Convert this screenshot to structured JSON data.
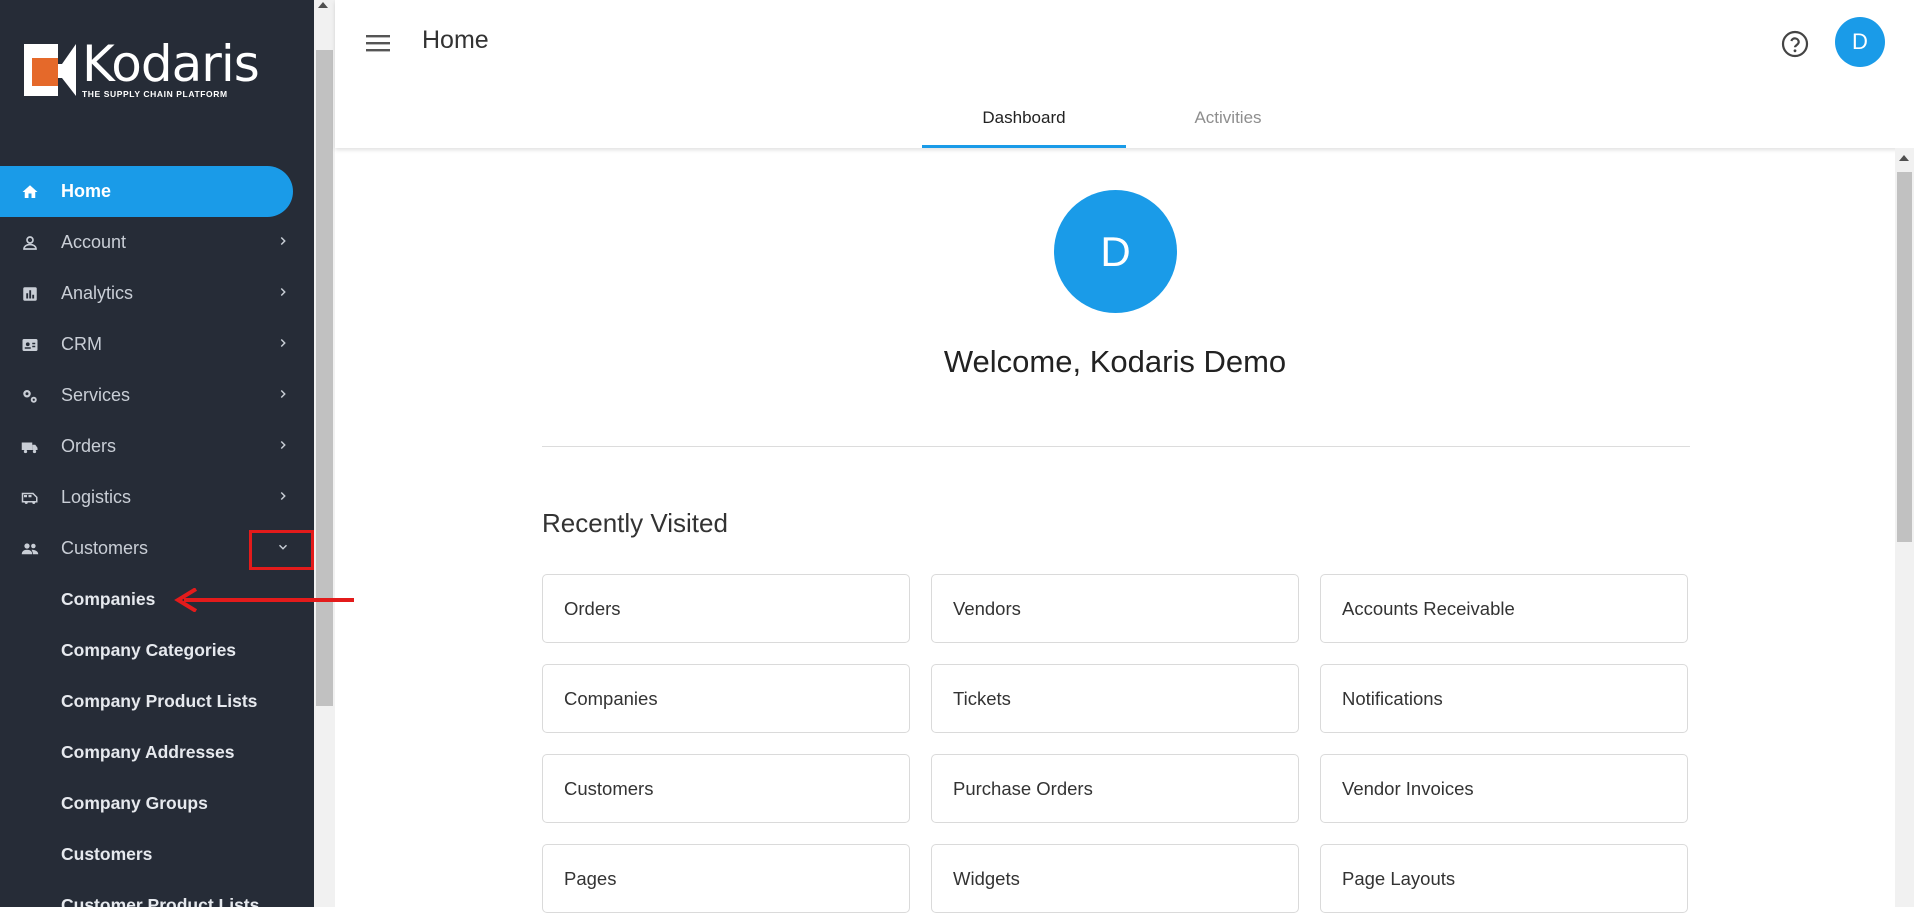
{
  "brand": {
    "name": "Kodaris",
    "tagline": "THE SUPPLY CHAIN PLATFORM",
    "accent": "#1a9be8",
    "logo_orange": "#e5692a"
  },
  "header": {
    "title": "Home",
    "avatar_initial": "D"
  },
  "tabs": [
    {
      "label": "Dashboard",
      "active": true
    },
    {
      "label": "Activities",
      "active": false
    }
  ],
  "sidebar": {
    "items": [
      {
        "label": "Home",
        "icon": "home-icon",
        "active": true
      },
      {
        "label": "Account",
        "icon": "person-icon"
      },
      {
        "label": "Analytics",
        "icon": "analytics-icon"
      },
      {
        "label": "CRM",
        "icon": "contact-card-icon"
      },
      {
        "label": "Services",
        "icon": "gears-icon"
      },
      {
        "label": "Orders",
        "icon": "truck-icon"
      },
      {
        "label": "Logistics",
        "icon": "shuttle-icon"
      },
      {
        "label": "Customers",
        "icon": "people-icon",
        "expanded": true
      }
    ],
    "sub_items": [
      "Companies",
      "Company Categories",
      "Company Product Lists",
      "Company Addresses",
      "Company Groups",
      "Customers",
      "Customer Product Lists"
    ]
  },
  "main": {
    "avatar_initial": "D",
    "welcome": "Welcome, Kodaris Demo",
    "recently_visited_title": "Recently Visited",
    "recently_visited": [
      "Orders",
      "Vendors",
      "Accounts Receivable",
      "Companies",
      "Tickets",
      "Notifications",
      "Customers",
      "Purchase Orders",
      "Vendor Invoices",
      "Pages",
      "Widgets",
      "Page Layouts"
    ]
  },
  "annotation_color": "#e31b1b"
}
